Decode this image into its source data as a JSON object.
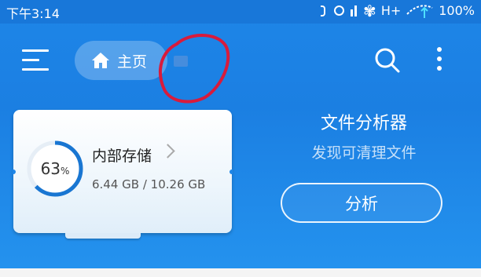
{
  "status_bar": {
    "time": "下午3:14",
    "network": "H+",
    "battery": "100%"
  },
  "toolbar": {
    "home_label": "主页"
  },
  "storage": {
    "percent_value": "63",
    "percent_sign": "%",
    "percent_used": 63,
    "title": "内部存储",
    "size": "6.44 GB / 10.26 GB"
  },
  "analyzer": {
    "title": "文件分析器",
    "subtitle": "发现可清理文件",
    "button_label": "分析"
  },
  "colors": {
    "header_blue": "#1e86e8",
    "ring_blue": "#1976d2",
    "annotation_red": "#d81b3c"
  }
}
